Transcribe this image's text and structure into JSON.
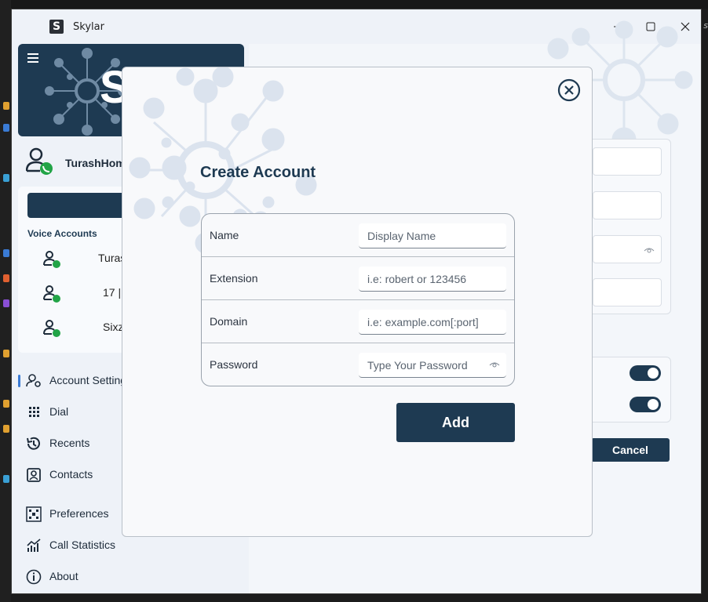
{
  "desktop": {
    "right_text": "s"
  },
  "app": {
    "title": "Skylar",
    "logo_letter": "S",
    "brand_text": "Sk"
  },
  "sidebar": {
    "profile_name": "TurashHom",
    "add_button": "Add",
    "voice_title": "Voice Accounts",
    "voice_accounts": [
      {
        "label": "Turas"
      },
      {
        "label": "17 |"
      },
      {
        "label": "Sixz"
      }
    ],
    "nav": [
      {
        "label": "Account Setting",
        "icon": "account-settings-icon"
      },
      {
        "label": "Dial",
        "icon": "dialpad-icon"
      },
      {
        "label": "Recents",
        "icon": "recents-icon"
      },
      {
        "label": "Contacts",
        "icon": "contacts-icon"
      },
      {
        "label": "Preferences",
        "icon": "preferences-icon"
      },
      {
        "label": "Call Statistics",
        "icon": "call-statistics-icon"
      },
      {
        "label": "About",
        "icon": "about-icon"
      }
    ]
  },
  "background": {
    "cancel_label": "Cancel",
    "toggles": [
      true,
      true
    ]
  },
  "modal": {
    "title": "Create Account",
    "fields": [
      {
        "label": "Name",
        "placeholder": "Display Name",
        "value": ""
      },
      {
        "label": "Extension",
        "placeholder": "i.e: robert or 123456",
        "value": ""
      },
      {
        "label": "Domain",
        "placeholder": "i.e: example.com[:port]",
        "value": ""
      },
      {
        "label": "Password",
        "placeholder": "Type Your Password",
        "value": ""
      }
    ],
    "add_label": "Add"
  },
  "colors": {
    "primary": "#1e3a52",
    "background": "#eef2f8",
    "online_badge": "#22a447"
  }
}
